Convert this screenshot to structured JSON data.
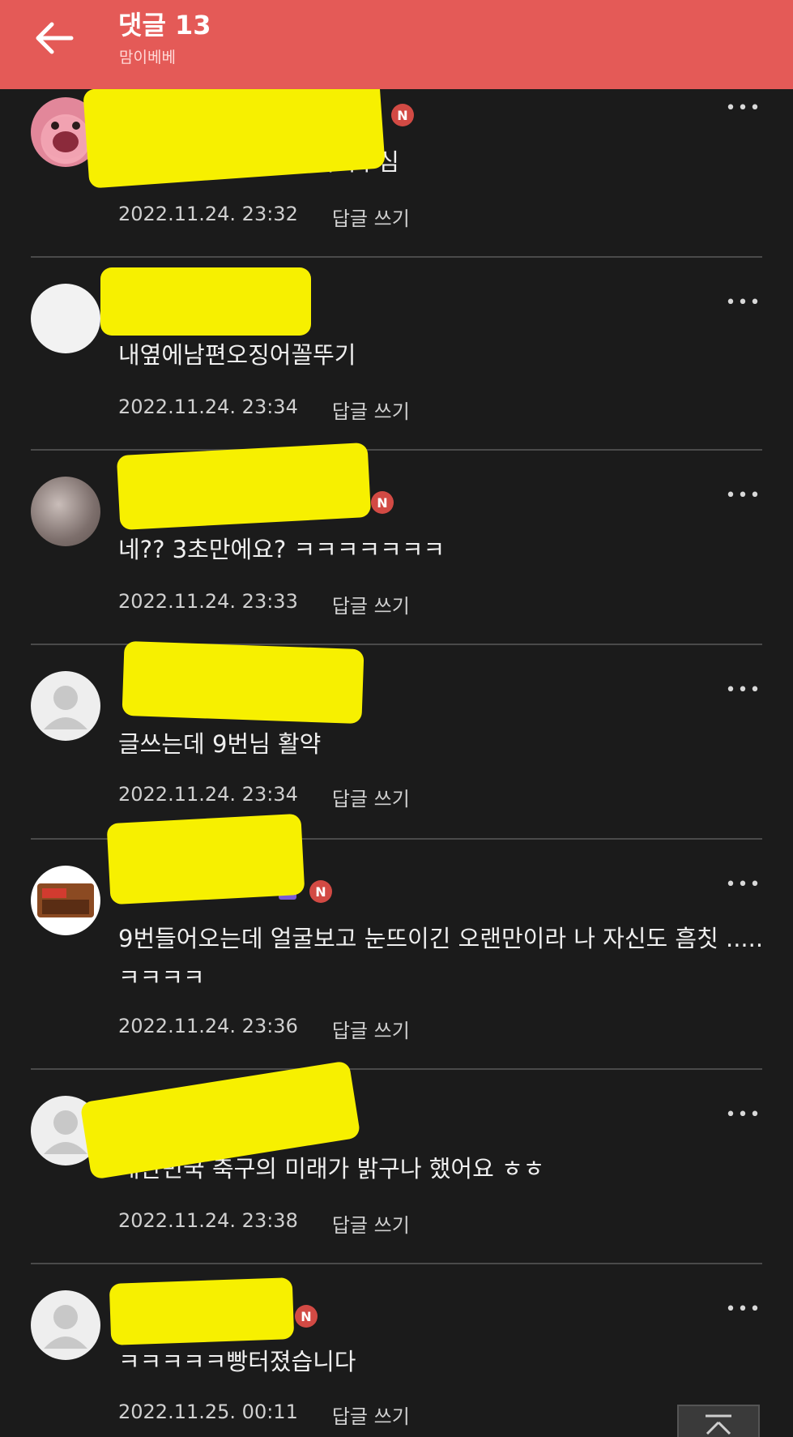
{
  "header": {
    "title": "댓글 13",
    "subtitle": "맘이베베"
  },
  "comments": [
    {
      "author": "",
      "badge": "N",
      "level": "",
      "text": "ㅋㅋㅋㅋㅋㅋㅋㅋㅋ귀여우심",
      "timestamp": "2022.11.24. 23:32",
      "reply_label": "답글 쓰기",
      "avatar": "pink"
    },
    {
      "author": "",
      "badge": "",
      "level": "",
      "text": "내옆에남편오징어꼴뚜기",
      "timestamp": "2022.11.24. 23:34",
      "reply_label": "답글 쓰기",
      "avatar": "blank"
    },
    {
      "author": "",
      "badge": "N",
      "level": "",
      "text": "네?? 3초만에요? ㅋㅋㅋㅋㅋㅋㅋ",
      "timestamp": "2022.11.24. 23:33",
      "reply_label": "답글 쓰기",
      "avatar": "photo"
    },
    {
      "author": "",
      "badge": "",
      "level": "",
      "text": "글쓰는데 9번님 활약",
      "timestamp": "2022.11.24. 23:34",
      "reply_label": "답글 쓰기",
      "avatar": "default"
    },
    {
      "author": "",
      "badge": "N",
      "level": "1",
      "text": "9번들어오는데 얼굴보고 눈뜨이긴 오랜만이라 나 자신도 흠칫 ..... ㅋㅋㅋㅋ",
      "timestamp": "2022.11.24. 23:36",
      "reply_label": "답글 쓰기",
      "avatar": "product"
    },
    {
      "author": "",
      "badge": "",
      "level": "",
      "text": "대한민국 축구의 미래가 밝구나 했어요 ㅎㅎ",
      "timestamp": "2022.11.24. 23:38",
      "reply_label": "답글 쓰기",
      "avatar": "default"
    },
    {
      "author": "",
      "badge": "N",
      "level": "",
      "text": "ㅋㅋㅋㅋㅋ빵터졌습니다",
      "timestamp": "2022.11.25. 00:11",
      "reply_label": "답글 쓰기",
      "avatar": "default"
    }
  ],
  "colors": {
    "header_bg": "#e45a57",
    "page_bg": "#1b1b1b",
    "badge_new": "#d24a44",
    "redaction": "#f7f000"
  },
  "icons": {
    "back": "arrow-left-icon",
    "more": "more-dots-icon",
    "top": "scroll-top-icon"
  }
}
